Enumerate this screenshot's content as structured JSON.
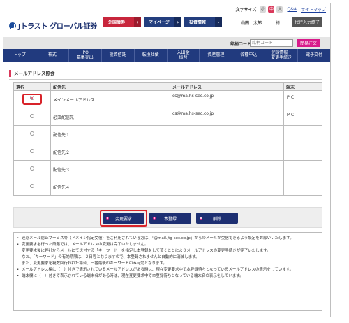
{
  "header": {
    "font_size_label": "文字サイズ",
    "font_sizes": [
      "小",
      "中",
      "大"
    ],
    "qa_link": "Q&A",
    "sitemap_link": "サイトマップ",
    "brand": "Jトラスト グローバル証券",
    "top_buttons": [
      {
        "label": "外国債券",
        "arrow": "›"
      },
      {
        "label": "マイページ",
        "arrow": "›"
      },
      {
        "label": "投資情報",
        "arrow": "›"
      }
    ],
    "user_name": "山田　太郎",
    "honorific": "様",
    "orders_button": "代行入力終了"
  },
  "search": {
    "label": "銘柄コード",
    "placeholder": "銘柄コード",
    "button": "簡易注文"
  },
  "nav": [
    "トップ",
    "株式",
    "IPO\n募集売出",
    "投資信託",
    "転換社債",
    "入出金\n振替",
    "資産管理",
    "各種申込",
    "登録情報・\n変更手続き",
    "電子交付"
  ],
  "page_title": "メールアドレス照会",
  "table": {
    "headers": [
      "選択",
      "配信先",
      "メールアドレス",
      "端末"
    ],
    "rows": [
      {
        "selected": true,
        "destination": "メインメールアドレス",
        "email": "cs@ma.hs-sec.co.jp",
        "terminal": "ＰＣ"
      },
      {
        "selected": false,
        "destination": "必須配信先",
        "email": "cs@ma.hs-sec.co.jp",
        "terminal": "ＰＣ"
      },
      {
        "selected": false,
        "destination": "配信先１",
        "email": "",
        "terminal": ""
      },
      {
        "selected": false,
        "destination": "配信先２",
        "email": "",
        "terminal": ""
      },
      {
        "selected": false,
        "destination": "配信先３",
        "email": "",
        "terminal": ""
      },
      {
        "selected": false,
        "destination": "配信先４",
        "email": "",
        "terminal": ""
      }
    ]
  },
  "actions": {
    "change": "変更要求",
    "register": "本登録",
    "delete": "削除"
  },
  "notes": [
    {
      "bullet": true,
      "text": "迷惑メール防止サービス等（ドメイン指定受信）をご利用されている方は、「@mail.jtg-sec.co.jp」からのメールが受信できるよう設定をお願いいたします。"
    },
    {
      "bullet": true,
      "text": "変更要求を行った段階では、メールアドレスの変更は完了いたしません。"
    },
    {
      "bullet": false,
      "text": "変更要求後に弊社からメールにて送付する「キーワード」を指定し本登録をして頂くことによりメールアドレスの変更手続きが完了いたします。"
    },
    {
      "bullet": false,
      "text": "なお、「キーワード」の有効期限は、２日程となりますので、本登録されませんと自動的に消滅します。"
    },
    {
      "bullet": false,
      "text": "また、変更要求を複数回行われた場合、一番最後のキーワードのみ有効となります。"
    },
    {
      "bullet": true,
      "text": "メールアドレス欄に（　）付きで表示されているメールアドレスがある時は、現在変更要求中で本登録待ちとなっているメールアドレスの表示をしています。"
    },
    {
      "bullet": true,
      "text": "端末欄に（　）付きで表示されている端末名がある時は、現在変更要求中で本登録待ちとなっている端末名の表示をしています。"
    }
  ]
}
